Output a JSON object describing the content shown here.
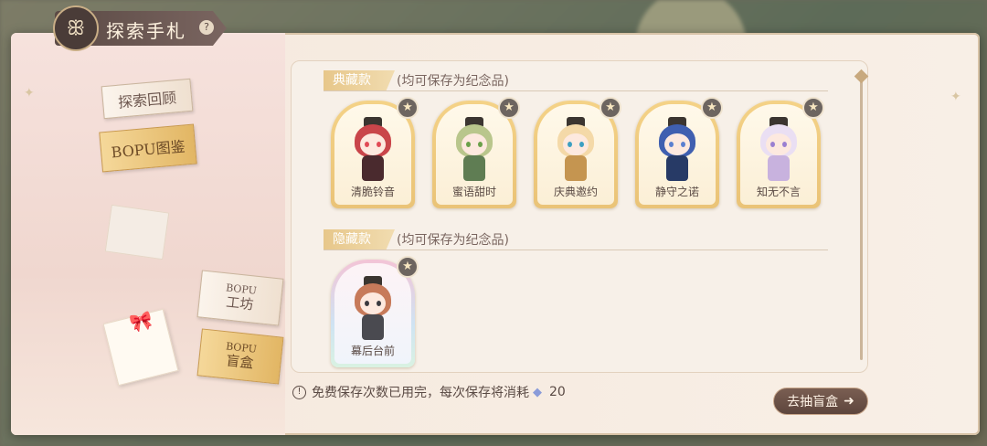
{
  "header": {
    "title": "探索手札",
    "emblem_icon": "butterfly-icon",
    "help_icon": "question-diamond-icon"
  },
  "side_tabs": {
    "review": "探索回顾",
    "atlas": "BOPU图鉴",
    "workshop": {
      "sub": "BOPU",
      "main": "工坊"
    },
    "blindbox": {
      "sub": "BOPU",
      "main": "盲盒"
    }
  },
  "sections": {
    "collection": {
      "tag": "典藏款",
      "note": "(均可保存为纪念品)"
    },
    "hidden": {
      "tag": "隐藏款",
      "note": "(均可保存为纪念品)"
    }
  },
  "collection_items": [
    {
      "name": "清脆铃音",
      "hair": "#c9454a",
      "body": "#4a2a2e",
      "eye": "#e14a56"
    },
    {
      "name": "蜜语甜时",
      "hair": "#b9c68c",
      "body": "#5f7d53",
      "eye": "#6aa04a"
    },
    {
      "name": "庆典邀约",
      "hair": "#f4d9a8",
      "body": "#c59550",
      "eye": "#3c9fc2"
    },
    {
      "name": "静守之诺",
      "hair": "#3f5fb0",
      "body": "#273a66",
      "eye": "#5a7fd0"
    },
    {
      "name": "知无不言",
      "hair": "#eadff3",
      "body": "#c8b2de",
      "eye": "#9a7fd1"
    }
  ],
  "hidden_items": [
    {
      "name": "幕后台前",
      "hair": "#c77a5a",
      "body": "#4a4a50",
      "eye": "#3a3a40"
    }
  ],
  "badge_icon": "star-icon",
  "footer": {
    "warning_icon": "warning-circle-icon",
    "notice": "免费保存次数已用完，每次保存将消耗",
    "gem_icon": "diamond-gem-icon",
    "cost": "20"
  },
  "draw_button": {
    "label": "去抽盲盒",
    "icon": "arrow-right-icon"
  },
  "colors": {
    "accent_gold": "#e7c78a",
    "button_brown": "#6a5046"
  }
}
